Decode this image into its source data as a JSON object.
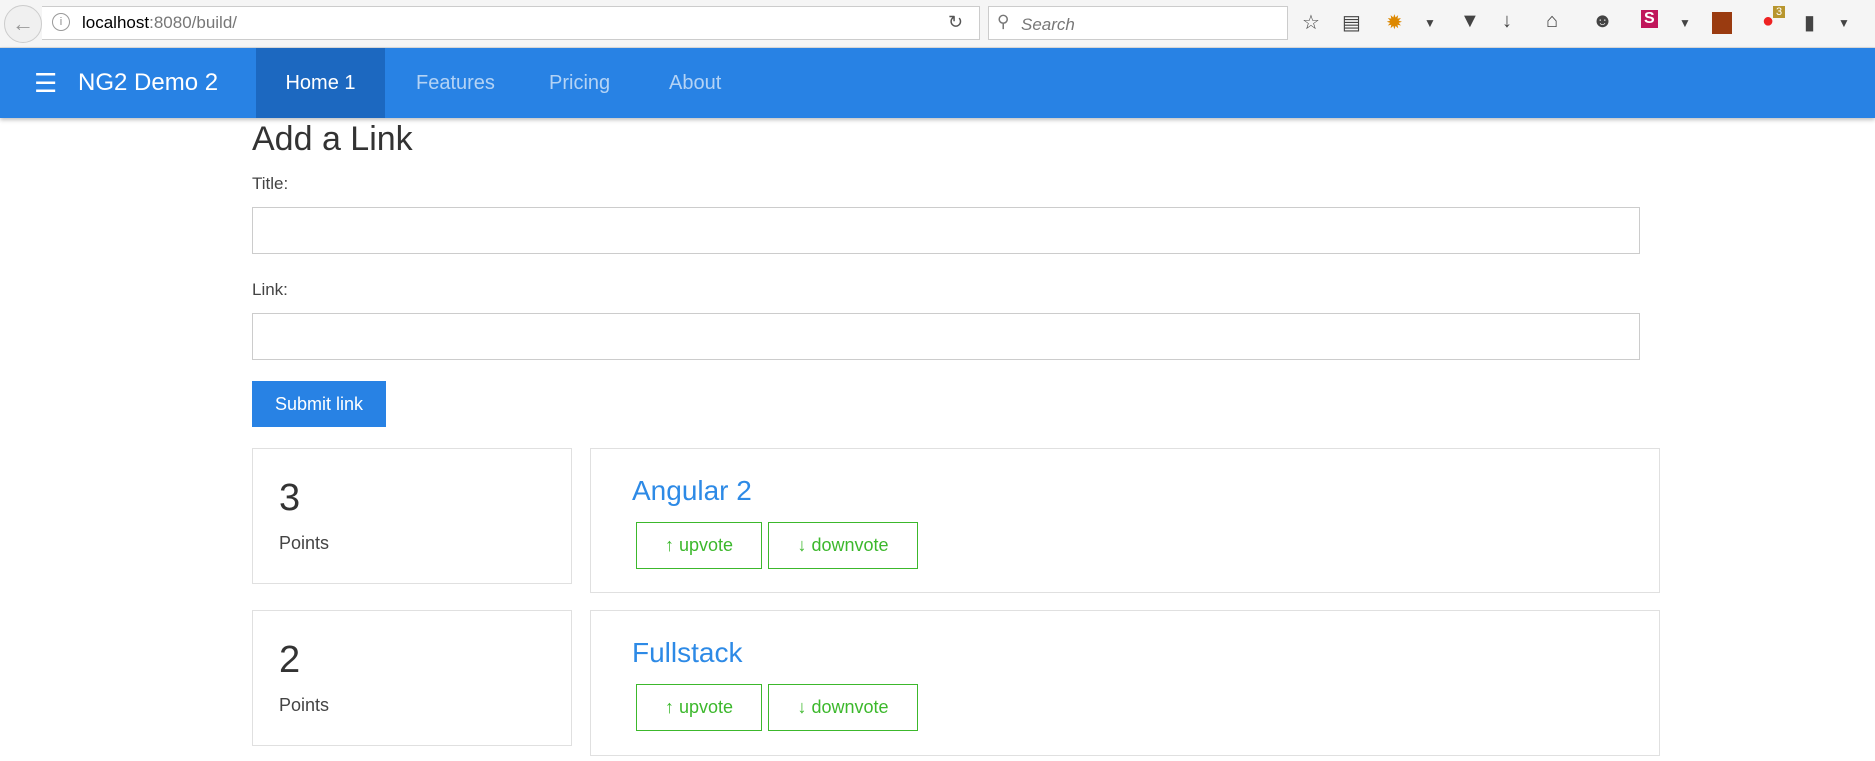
{
  "browser": {
    "url_host": "localhost",
    "url_rest": ":8080/build/",
    "search_placeholder": "Search",
    "badge_count": "3"
  },
  "navbar": {
    "brand": "NG2 Demo 2",
    "tabs": [
      {
        "label": "Home 1",
        "active": true
      },
      {
        "label": "Features"
      },
      {
        "label": "Pricing"
      },
      {
        "label": "About"
      }
    ],
    "color": "#2882e4"
  },
  "form": {
    "heading": "Add a Link",
    "title_label": "Title:",
    "title_value": "",
    "link_label": "Link:",
    "link_value": "",
    "submit_label": "Submit link"
  },
  "links": [
    {
      "points": "3",
      "points_label": "Points",
      "title": "Angular 2",
      "upvote": "upvote",
      "downvote": "downvote"
    },
    {
      "points": "2",
      "points_label": "Points",
      "title": "Fullstack",
      "upvote": "upvote",
      "downvote": "downvote"
    }
  ]
}
